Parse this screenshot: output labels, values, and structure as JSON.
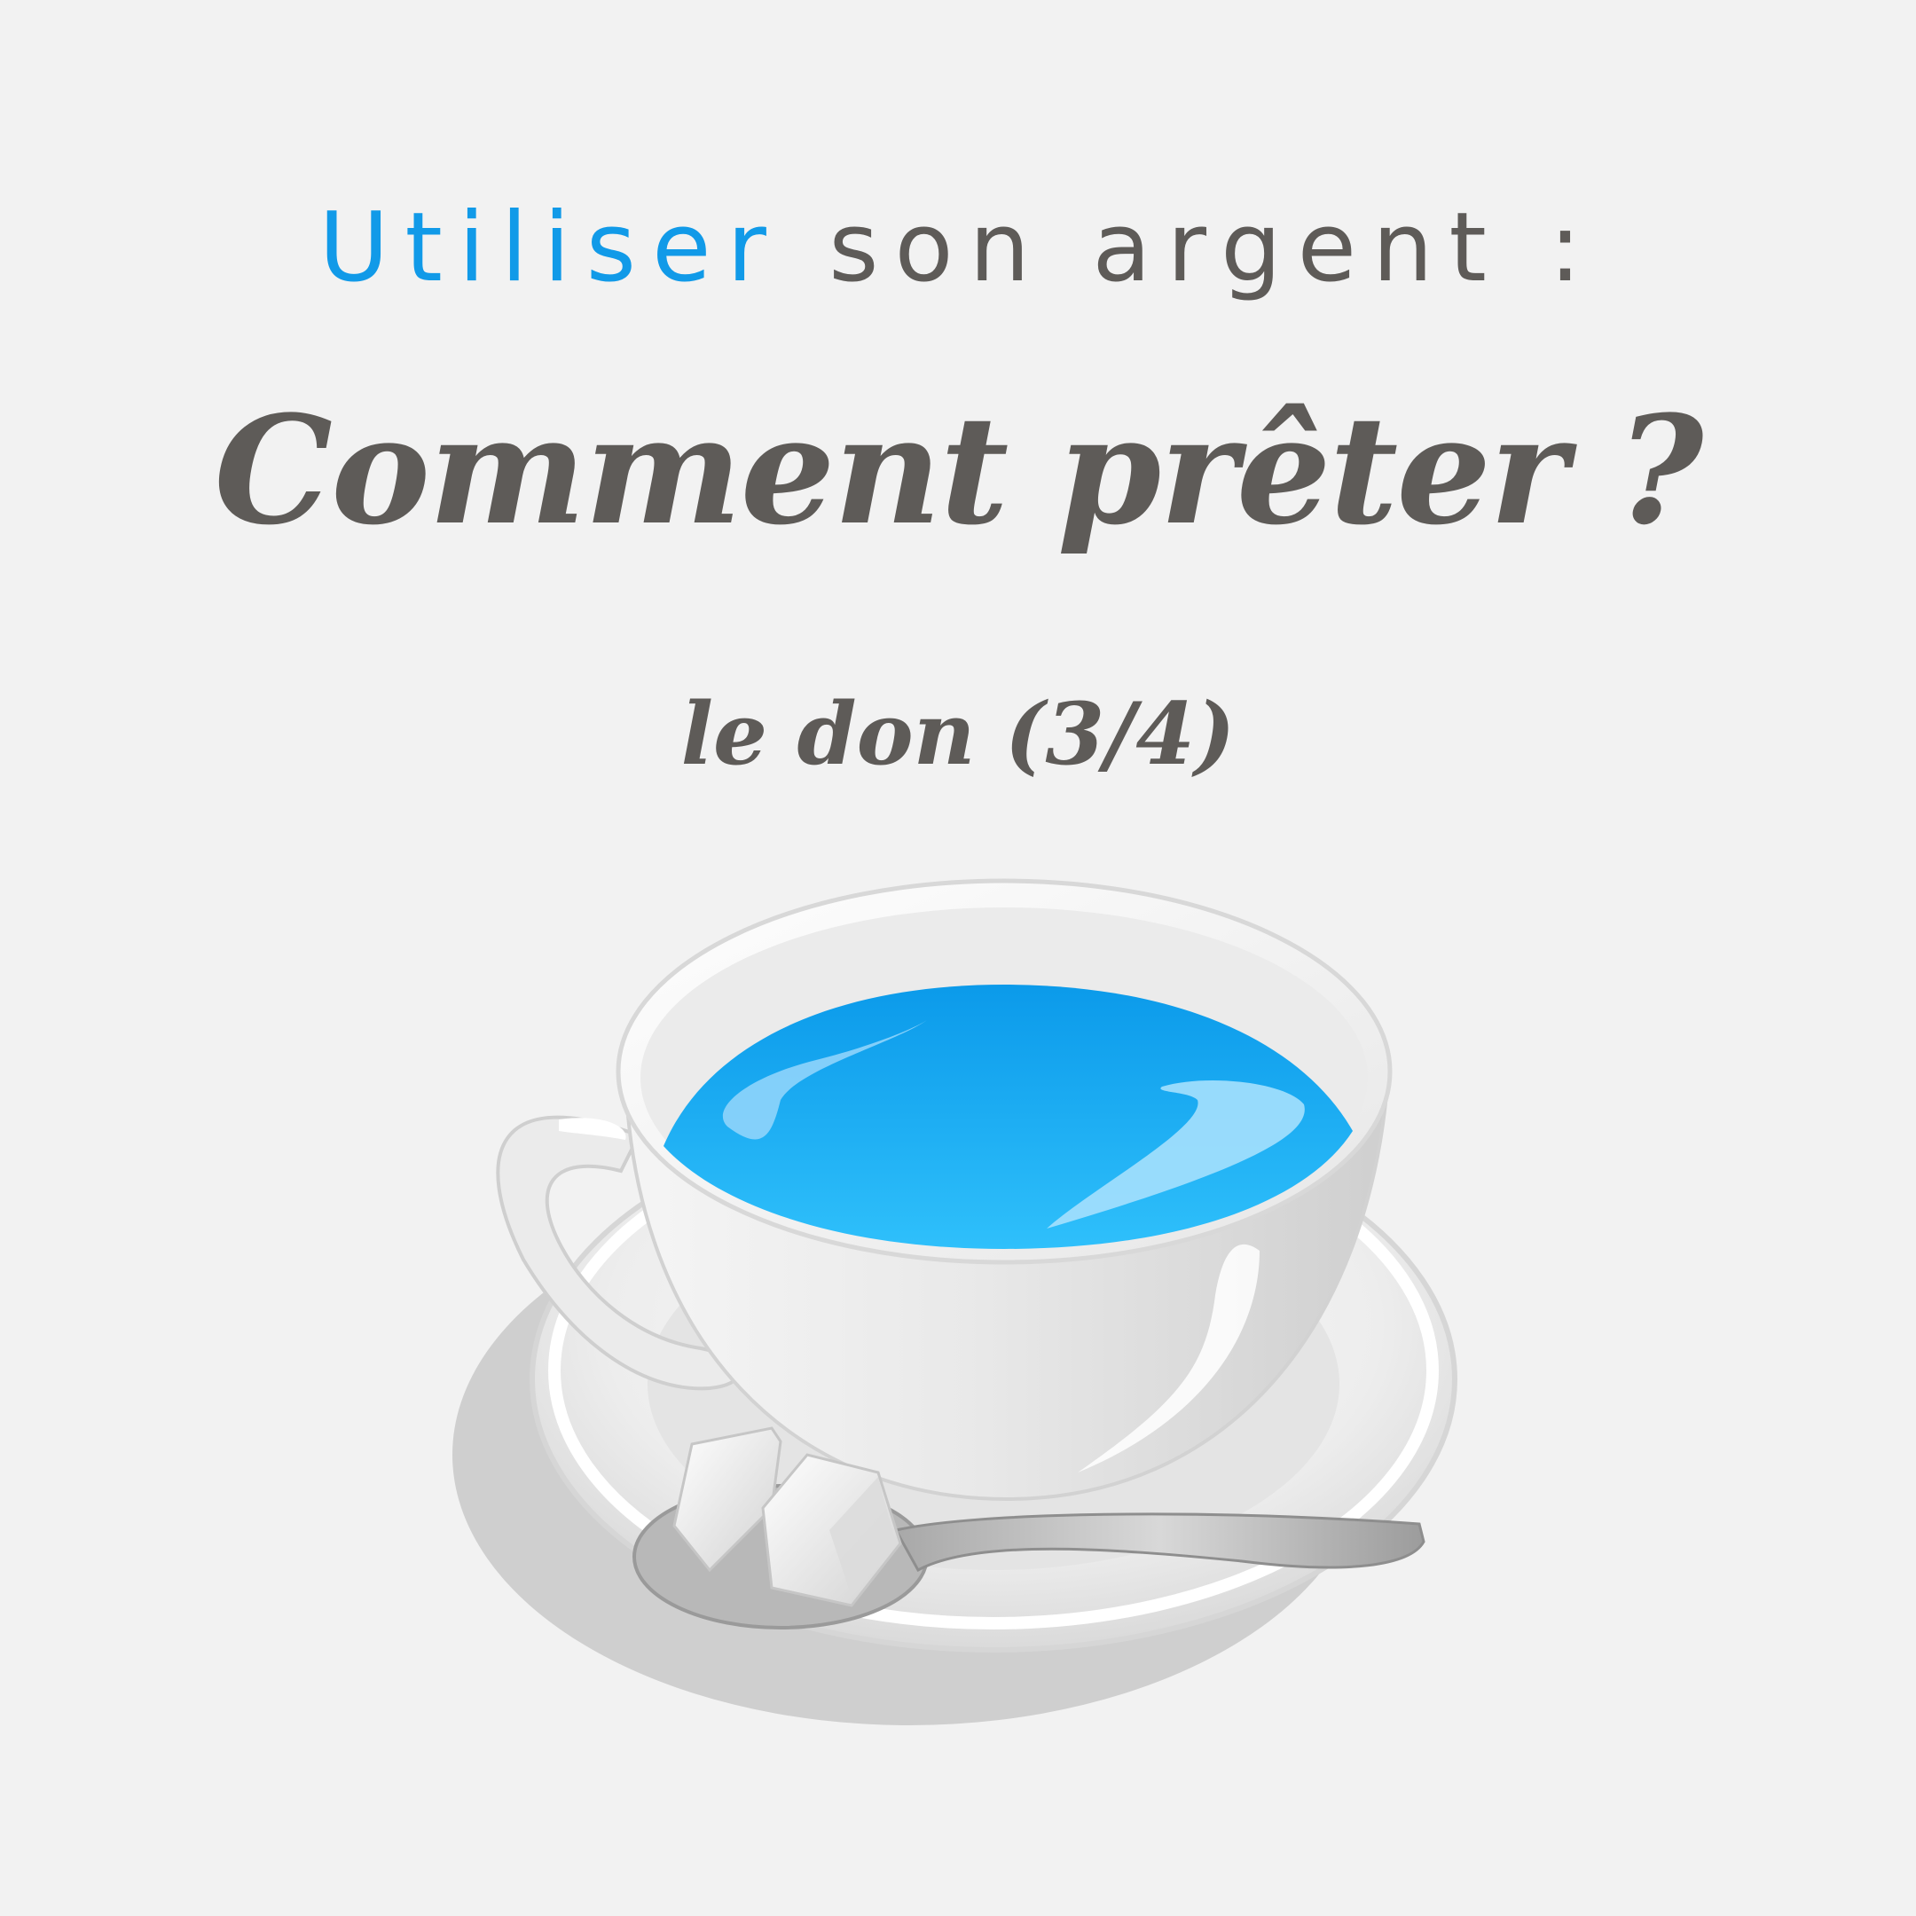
{
  "header": {
    "kicker_highlight": "Utiliser",
    "kicker_rest": "son argent :",
    "title": "Comment prêter ?",
    "subtitle": "le don (3/4)"
  },
  "colors": {
    "background": "#f2f2f2",
    "text": "#5e5b58",
    "accent": "#119ae8",
    "liquid": "#2ebcf8",
    "liquid_dark": "#0b9aea"
  },
  "illustration": {
    "icon": "teacup-with-sugar-cubes-icon"
  }
}
